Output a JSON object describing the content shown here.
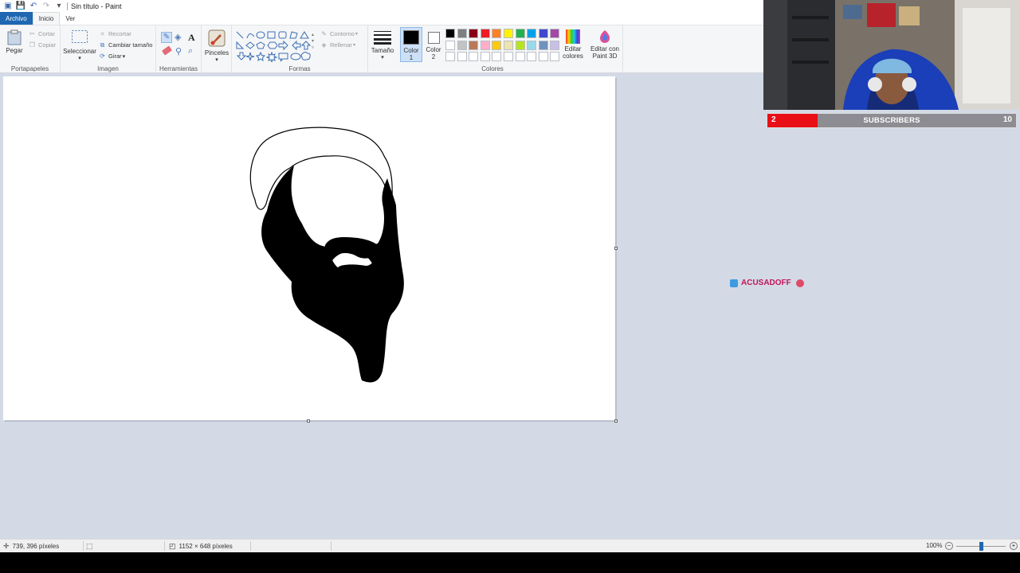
{
  "window": {
    "title": "Sin título - Paint"
  },
  "menu": {
    "tabs": [
      "Archivo",
      "Inicio",
      "Ver"
    ]
  },
  "ribbon": {
    "clipboard": {
      "paste": "Pegar",
      "cut": "Cortar",
      "copy": "Copiar",
      "label": "Portapapeles"
    },
    "image": {
      "select": "Seleccionar",
      "crop": "Recortar",
      "resize": "Cambiar tamaño",
      "rotate": "Girar",
      "label": "Imagen"
    },
    "tools": {
      "label": "Herramientas"
    },
    "brushes": {
      "label": "Pinceles"
    },
    "shapes": {
      "outline": "Contorno",
      "fill": "Rellenar",
      "label": "Formas"
    },
    "size": {
      "label": "Tamaño"
    },
    "colors": {
      "color1_line1": "Color",
      "color1_line2": "1",
      "color2_line1": "Color",
      "color2_line2": "2",
      "edit_line1": "Editar",
      "edit_line2": "colores",
      "paint3d_line1": "Editar con",
      "paint3d_line2": "Paint 3D",
      "label": "Colores",
      "color1_value": "#000000",
      "color2_value": "#ffffff",
      "palette_row1": [
        "#000000",
        "#7f7f7f",
        "#880015",
        "#ed1c24",
        "#ff7f27",
        "#fff200",
        "#22b14c",
        "#00a2e8",
        "#3f48cc",
        "#a349a4"
      ],
      "palette_row2": [
        "#ffffff",
        "#c3c3c3",
        "#b97a57",
        "#ffaec9",
        "#ffc90e",
        "#efe4b0",
        "#b5e61d",
        "#99d9ea",
        "#7092be",
        "#c8bfe7"
      ],
      "palette_row3": [
        "#ffffff",
        "#ffffff",
        "#ffffff",
        "#ffffff",
        "#ffffff",
        "#ffffff",
        "#ffffff",
        "#ffffff",
        "#ffffff",
        "#ffffff"
      ]
    }
  },
  "overlay": {
    "subscribers": {
      "current": "2",
      "label": "SUBSCRIBERS",
      "goal": "10",
      "progress_fraction": 0.2
    },
    "alert_name": "ACUSADOFF"
  },
  "status": {
    "cursor_pos": "739, 396 píxeles",
    "canvas_size": "1152 × 648 píxeles",
    "zoom": "100%"
  }
}
